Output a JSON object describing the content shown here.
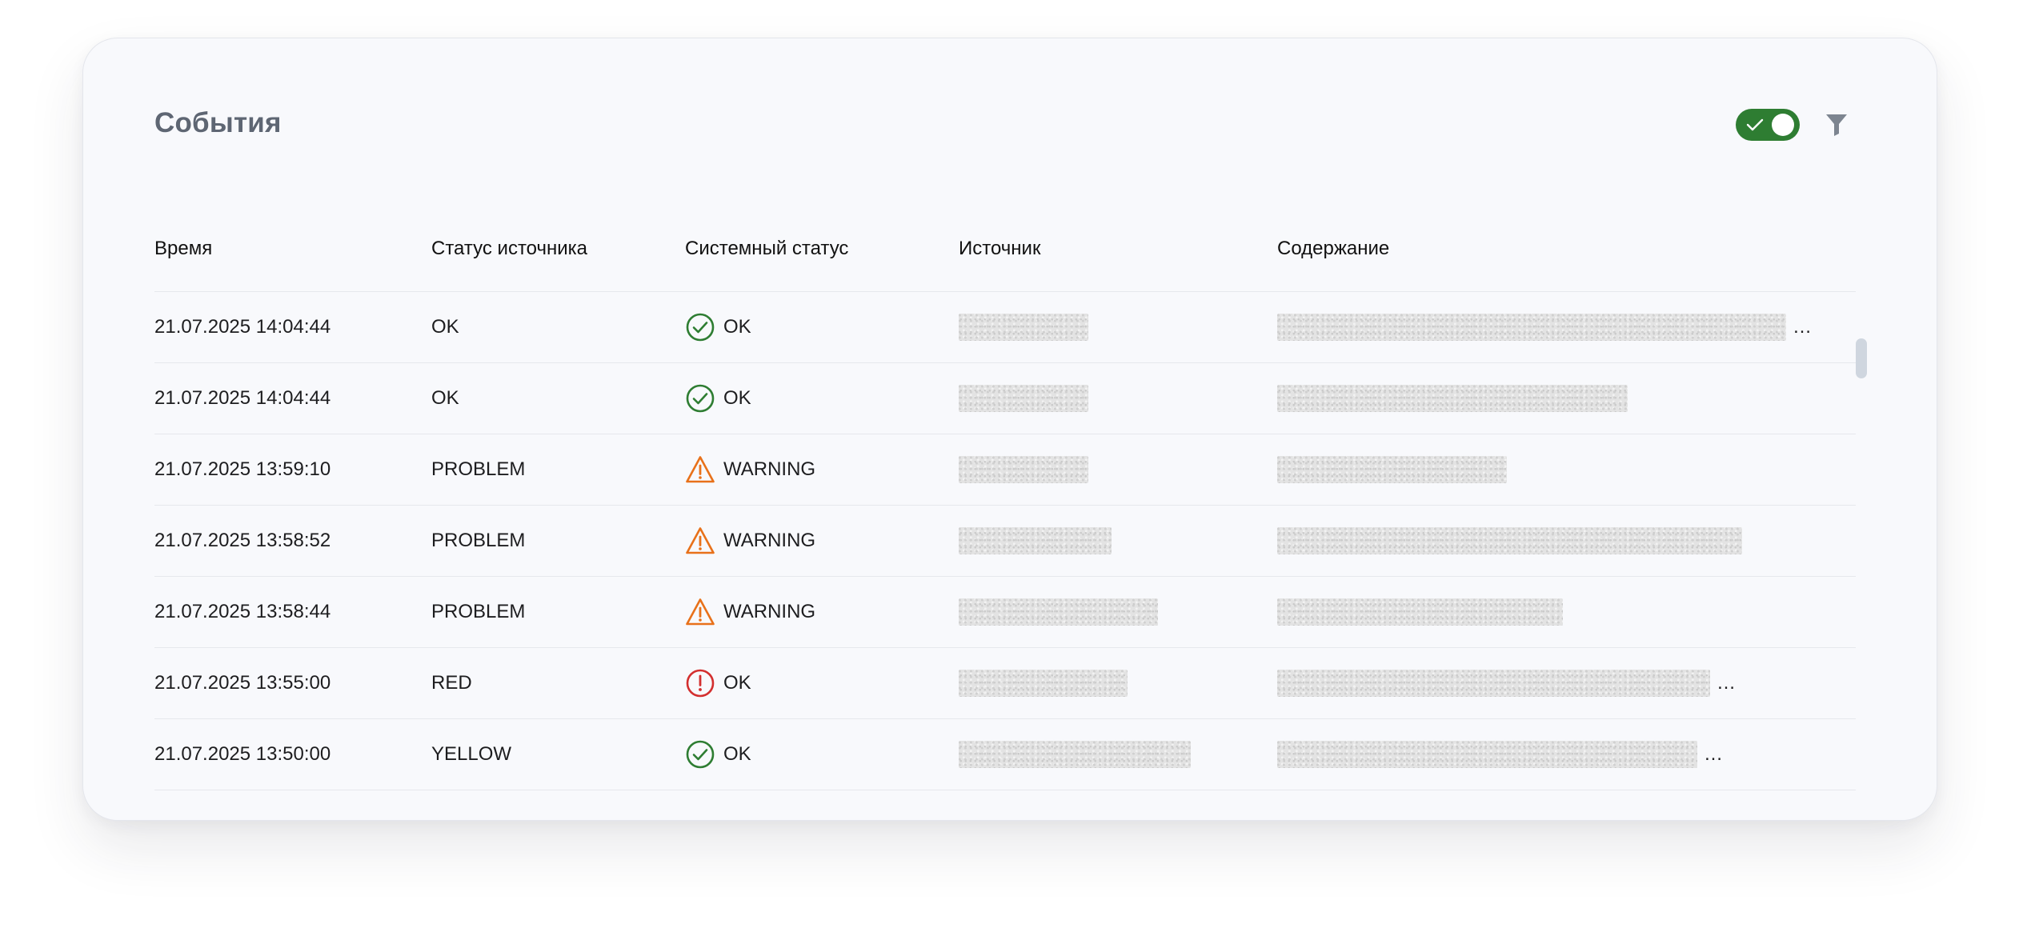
{
  "panel": {
    "title": "События",
    "live_toggle": {
      "on": true,
      "icon": "check-icon",
      "color": "#2e7d32"
    },
    "filter_icon": "filter-icon"
  },
  "table": {
    "columns": [
      "Время",
      "Статус источника",
      "Системный статус",
      "Источник",
      "Содержание"
    ],
    "rows": [
      {
        "time": "21.07.2025 14:04:44",
        "source_status": "OK",
        "system_status": "OK",
        "system_icon": "check-circle-icon",
        "truncated": true,
        "ellipsis": "…"
      },
      {
        "time": "21.07.2025 14:04:44",
        "source_status": "OK",
        "system_status": "OK",
        "system_icon": "check-circle-icon",
        "truncated": false,
        "ellipsis": ""
      },
      {
        "time": "21.07.2025 13:59:10",
        "source_status": "PROBLEM",
        "system_status": "WARNING",
        "system_icon": "warning-triangle-icon",
        "truncated": false,
        "ellipsis": ""
      },
      {
        "time": "21.07.2025 13:58:52",
        "source_status": "PROBLEM",
        "system_status": "WARNING",
        "system_icon": "warning-triangle-icon",
        "truncated": false,
        "ellipsis": ""
      },
      {
        "time": "21.07.2025 13:58:44",
        "source_status": "PROBLEM",
        "system_status": "WARNING",
        "system_icon": "warning-triangle-icon",
        "truncated": false,
        "ellipsis": ""
      },
      {
        "time": "21.07.2025 13:55:00",
        "source_status": "RED",
        "system_status": "OK",
        "system_icon": "error-circle-icon",
        "truncated": true,
        "ellipsis": "…"
      },
      {
        "time": "21.07.2025 13:50:00",
        "source_status": "YELLOW",
        "system_status": "OK",
        "system_icon": "check-circle-icon",
        "truncated": true,
        "ellipsis": "…"
      }
    ]
  },
  "colors": {
    "ok": "#2e7d32",
    "warning": "#e8711a",
    "error": "#d32f2f",
    "title": "#5e6673",
    "filter": "#7d8590"
  }
}
